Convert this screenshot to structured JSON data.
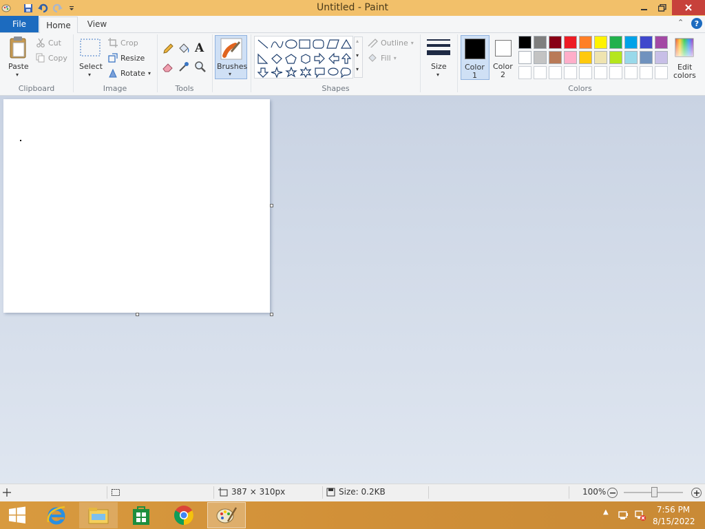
{
  "window": {
    "title": "Untitled - Paint"
  },
  "tabs": {
    "file": "File",
    "home": "Home",
    "view": "View"
  },
  "clipboard": {
    "paste": "Paste",
    "cut": "Cut",
    "copy": "Copy",
    "group": "Clipboard"
  },
  "image": {
    "select": "Select",
    "crop": "Crop",
    "resize": "Resize",
    "rotate": "Rotate",
    "group": "Image"
  },
  "tools": {
    "group": "Tools"
  },
  "brushes": {
    "label": "Brushes"
  },
  "shapes": {
    "outline": "Outline",
    "fill": "Fill",
    "group": "Shapes"
  },
  "size": {
    "label": "Size"
  },
  "colors": {
    "color1_a": "Color",
    "color1_b": "1",
    "color2_a": "Color",
    "color2_b": "2",
    "edit_a": "Edit",
    "edit_b": "colors",
    "group": "Colors",
    "row1": [
      "#000000",
      "#7f7f7f",
      "#880015",
      "#ed1c24",
      "#ff7f27",
      "#fff200",
      "#22b14c",
      "#00a2e8",
      "#3f48cc",
      "#a349a4"
    ],
    "row2": [
      "#ffffff",
      "#c3c3c3",
      "#b97a57",
      "#ffaec9",
      "#ffc90e",
      "#efe4b0",
      "#b5e61d",
      "#99d9ea",
      "#7092be",
      "#c8bfe7"
    ],
    "color1": "#000000",
    "color2": "#ffffff"
  },
  "status": {
    "dimensions": "387 × 310px",
    "size": "Size: 0.2KB",
    "zoom": "100%"
  },
  "taskbar": {
    "time": "7:56 PM",
    "date": "8/15/2022"
  }
}
